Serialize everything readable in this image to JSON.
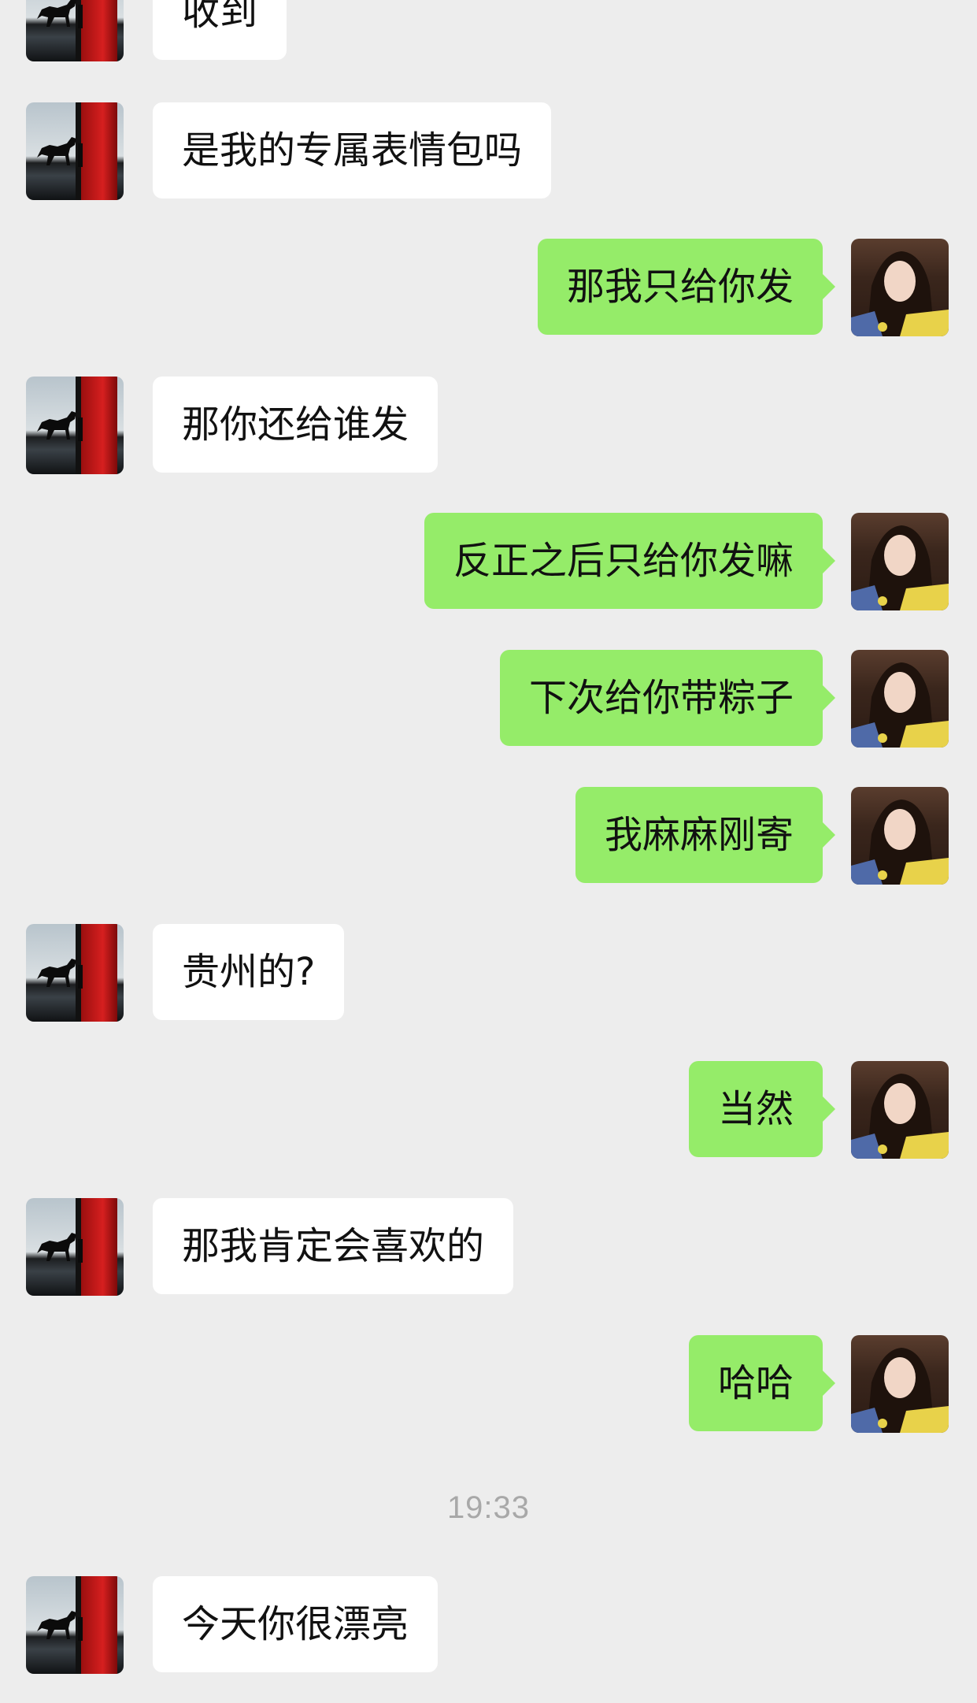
{
  "chat": {
    "messages": [
      {
        "side": "left",
        "text": "收到",
        "avatar": "horse-silhouette-avatar"
      },
      {
        "side": "left",
        "text": "是我的专属表情包吗",
        "avatar": "horse-silhouette-avatar"
      },
      {
        "side": "right",
        "text": "那我只给你发",
        "avatar": "girl-portrait-avatar"
      },
      {
        "side": "left",
        "text": "那你还给谁发",
        "avatar": "horse-silhouette-avatar"
      },
      {
        "side": "right",
        "text": "反正之后只给你发嘛",
        "avatar": "girl-portrait-avatar"
      },
      {
        "side": "right",
        "text": "下次给你带粽子",
        "avatar": "girl-portrait-avatar"
      },
      {
        "side": "right",
        "text": "我麻麻刚寄",
        "avatar": "girl-portrait-avatar"
      },
      {
        "side": "left",
        "text": "贵州的?",
        "avatar": "horse-silhouette-avatar"
      },
      {
        "side": "right",
        "text": "当然",
        "avatar": "girl-portrait-avatar"
      },
      {
        "side": "left",
        "text": "那我肯定会喜欢的",
        "avatar": "horse-silhouette-avatar"
      },
      {
        "side": "right",
        "text": "哈哈",
        "avatar": "girl-portrait-avatar"
      },
      {
        "side": "left",
        "text": "今天你很漂亮",
        "avatar": "horse-silhouette-avatar"
      }
    ],
    "timestamp": "19:33"
  },
  "colors": {
    "background": "#ededed",
    "incoming_bubble": "#ffffff",
    "outgoing_bubble": "#95ec69",
    "timestamp_text": "#a8a8a8"
  }
}
